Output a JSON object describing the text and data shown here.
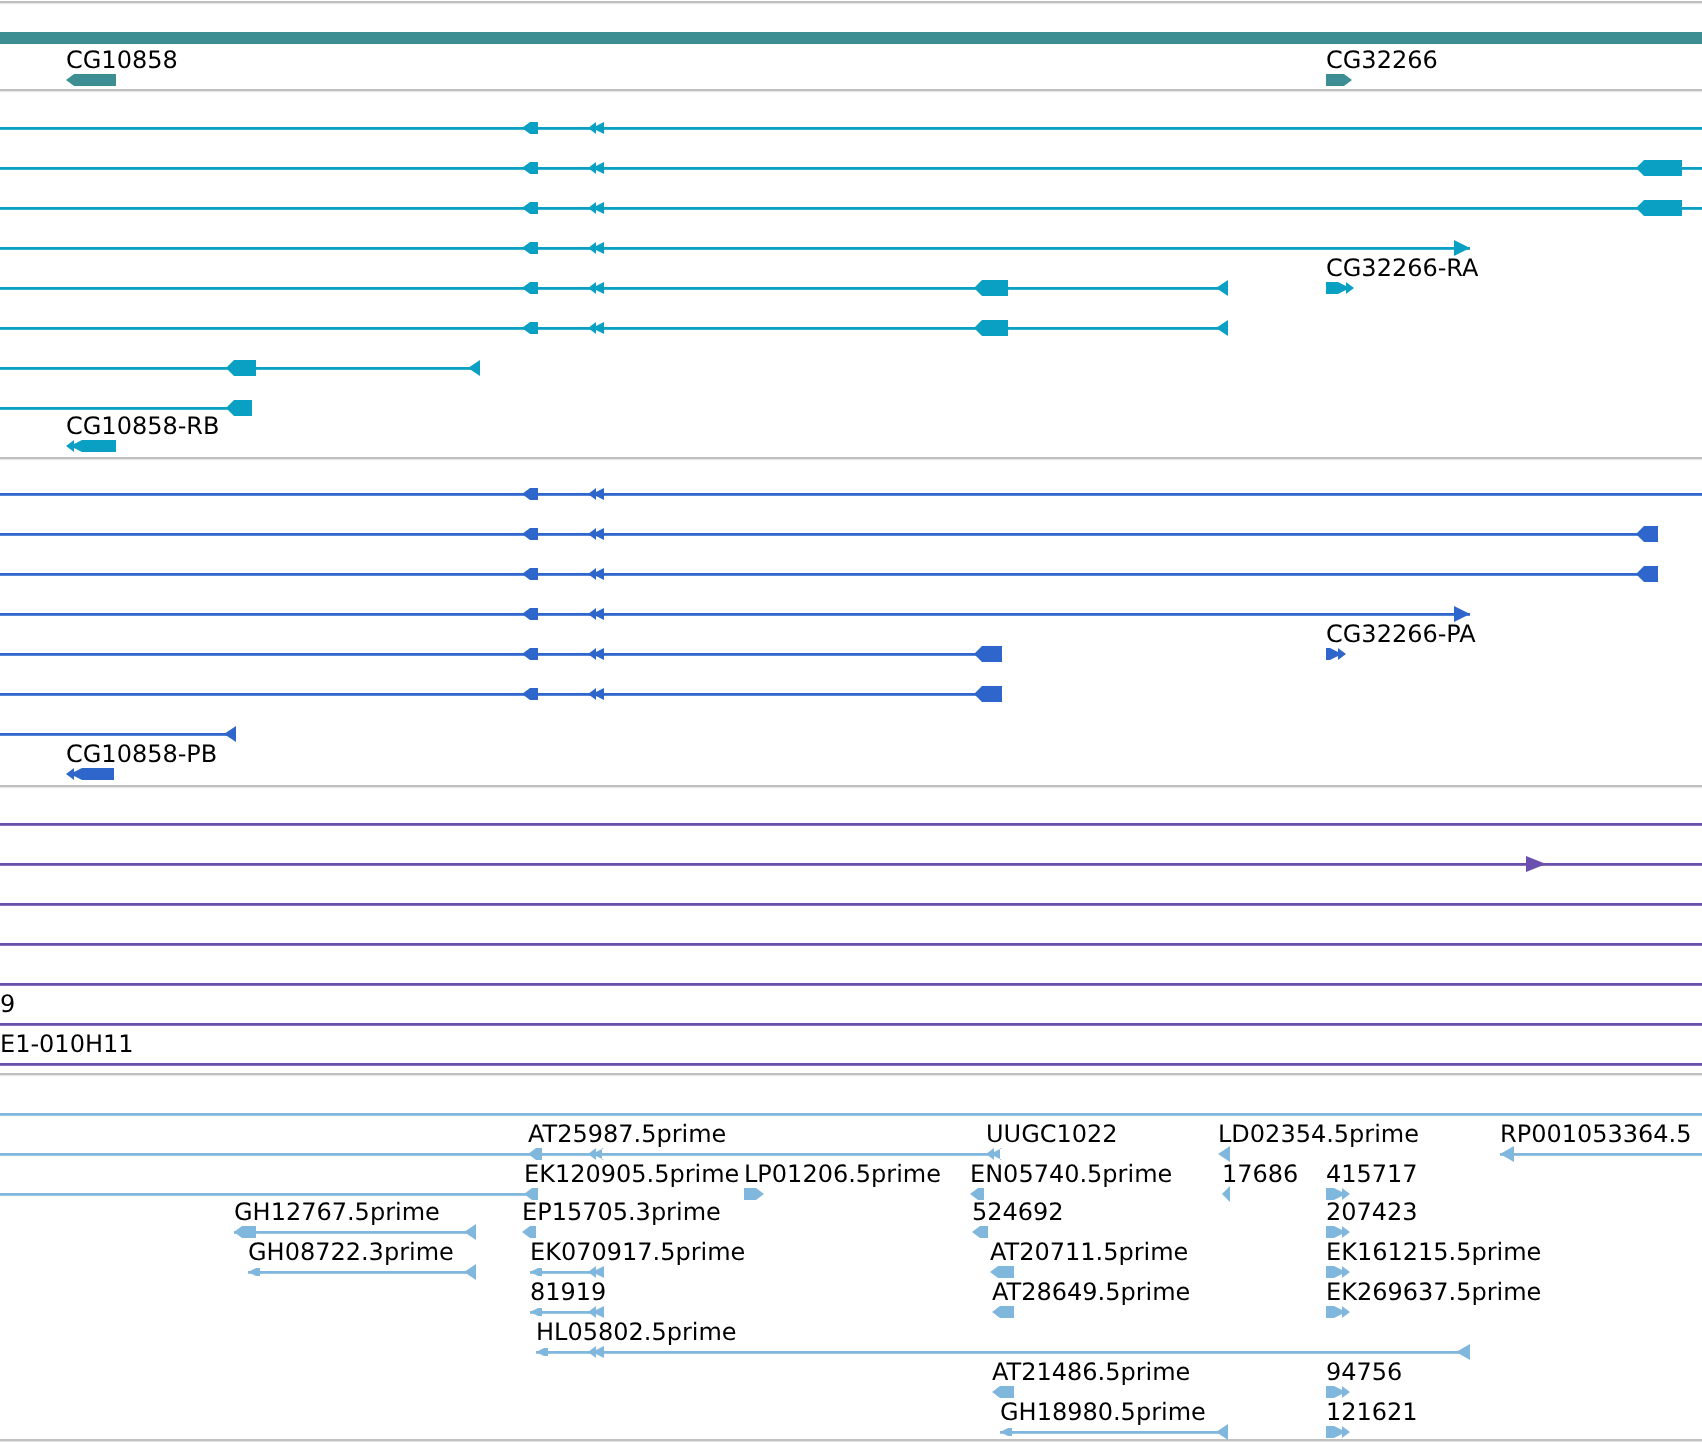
{
  "tracks": [
    {
      "kind": "genes",
      "color": "#3d8e93",
      "features": [
        "CG10858",
        "CG32266"
      ]
    },
    {
      "kind": "transcripts",
      "color": "#0aa0c4",
      "features": [
        "CG32266-RA",
        "CG10858-RB"
      ]
    },
    {
      "kind": "transcripts",
      "color": "#2f66cc",
      "features": [
        "CG32266-PA",
        "CG10858-PB"
      ]
    },
    {
      "kind": "clones",
      "color": "#6a4fae",
      "features": [
        "9",
        "E1-010H11"
      ]
    },
    {
      "kind": "ests",
      "color": "#80b8dd",
      "features": [
        "AT25987.5prime",
        "UUGC1022",
        "LD02354.5prime",
        "RP001053364.5",
        "EK120905.5prime",
        "LP01206.5prime",
        "EN05740.5prime",
        "17686",
        "415717",
        "GH12767.5prime",
        "EP15705.3prime",
        "524692",
        "207423",
        "GH08722.3prime",
        "EK070917.5prime",
        "AT20711.5prime",
        "EK161215.5prime",
        "81919",
        "AT28649.5prime",
        "EK269637.5prime",
        "HL05802.5prime",
        "AT21486.5prime",
        "94756",
        "GH18980.5prime",
        "121621"
      ]
    }
  ]
}
